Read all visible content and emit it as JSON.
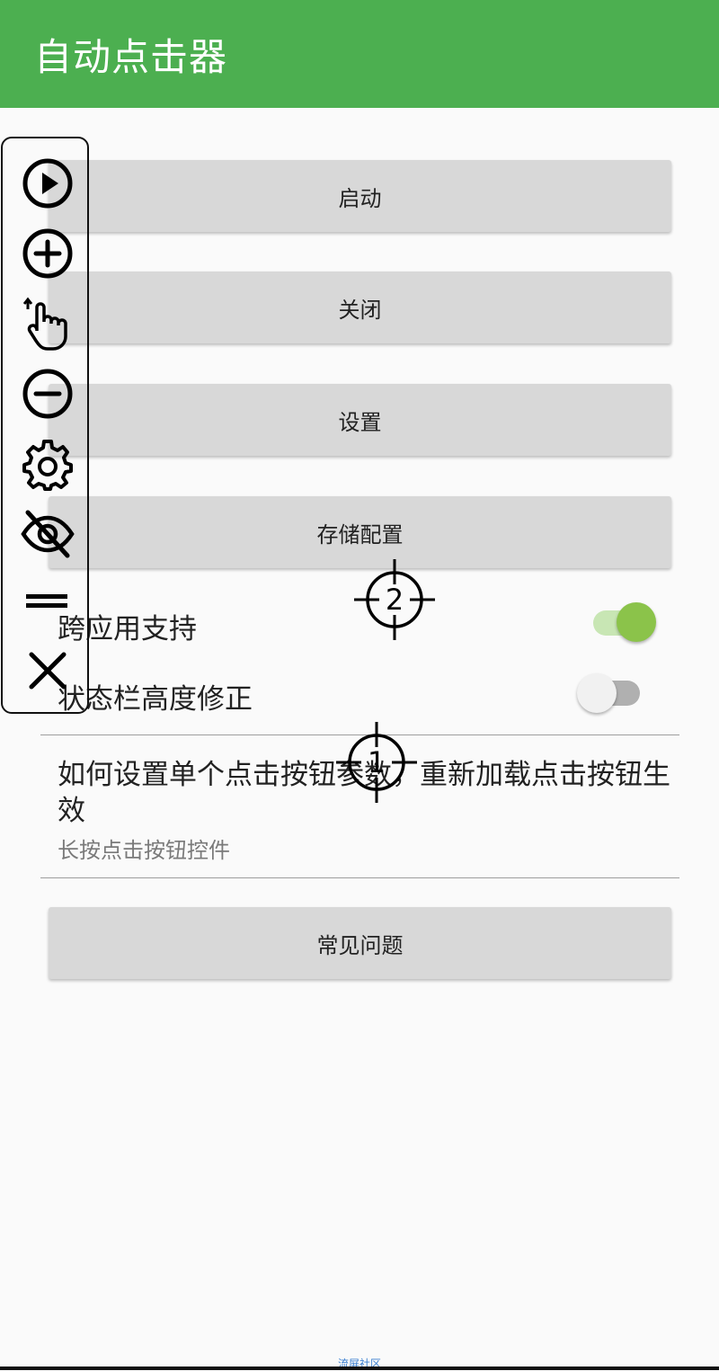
{
  "appbar": {
    "title": "自动点击器",
    "color": "#4caf50"
  },
  "buttons": {
    "start": "启动",
    "close": "关闭",
    "settings": "设置",
    "save_config": "存储配置",
    "faq": "常见问题"
  },
  "toggles": {
    "cross_app": {
      "label": "跨应用支持",
      "on": true,
      "on_color": "#8bc34a"
    },
    "status_bar": {
      "label": "状态栏高度修正",
      "on": false
    }
  },
  "info": {
    "title": "如何设置单个点击按钮参数，重新加载点击按钮生效",
    "subtitle": "长按点击按钮控件"
  },
  "toolbar": {
    "icons": [
      "play-icon",
      "plus-circle-icon",
      "swipe-hand-icon",
      "minus-circle-icon",
      "gear-icon",
      "eye-off-icon",
      "drag-handle-icon",
      "close-icon"
    ]
  },
  "targets": [
    {
      "num": "2"
    },
    {
      "num": "1"
    }
  ],
  "watermark": "流屏社区"
}
